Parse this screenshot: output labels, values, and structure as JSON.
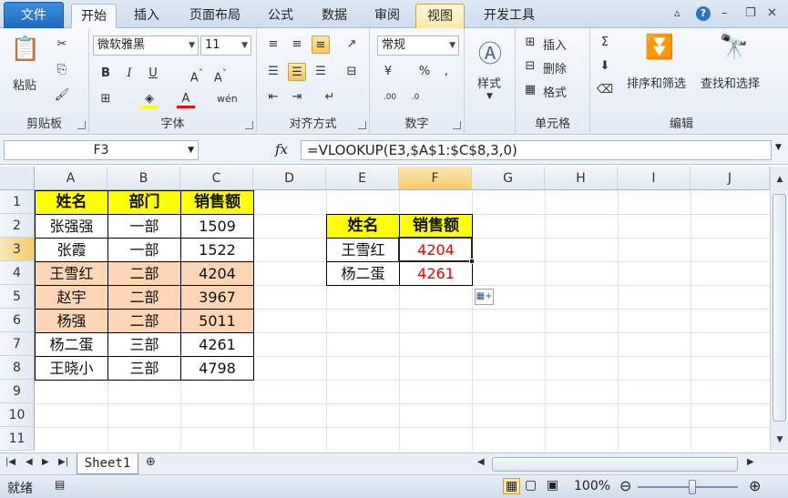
{
  "tabs": {
    "file": "文件",
    "items": [
      "开始",
      "插入",
      "页面布局",
      "公式",
      "数据",
      "审阅",
      "视图",
      "开发工具"
    ],
    "active": "开始",
    "hovered": "视图"
  },
  "ribbon": {
    "clipboard": {
      "label": "剪贴板",
      "paste": "粘贴"
    },
    "font": {
      "label": "字体",
      "name": "微软雅黑",
      "size": "11",
      "bold": "B",
      "italic": "I",
      "underline": "U"
    },
    "alignment": {
      "label": "对齐方式"
    },
    "number": {
      "label": "数字",
      "format": "常规"
    },
    "styles": {
      "label": "样式"
    },
    "cells": {
      "label": "单元格",
      "insert": "插入",
      "delete": "删除",
      "format": "格式"
    },
    "editing": {
      "label": "编辑",
      "sort_filter": "排序和筛选",
      "find_select": "查找和选择"
    }
  },
  "formula_bar": {
    "name_box": "F3",
    "fx": "fx",
    "formula": "=VLOOKUP(E3,$A$1:$C$8,3,0)"
  },
  "sheet": {
    "columns": [
      "A",
      "B",
      "C",
      "D",
      "E",
      "F",
      "G",
      "H",
      "I",
      "J"
    ],
    "rows": [
      "1",
      "2",
      "3",
      "4",
      "5",
      "6",
      "7",
      "8",
      "9",
      "10",
      "11"
    ],
    "selected_cell": "F3",
    "main_table": {
      "headers": [
        "姓名",
        "部门",
        "销售额"
      ],
      "rows": [
        [
          "张强强",
          "一部",
          "1509"
        ],
        [
          "张霞",
          "一部",
          "1522"
        ],
        [
          "王雪红",
          "二部",
          "4204"
        ],
        [
          "赵宇",
          "二部",
          "3967"
        ],
        [
          "杨强",
          "二部",
          "5011"
        ],
        [
          "杨二蛋",
          "三部",
          "4261"
        ],
        [
          "王晓小",
          "三部",
          "4798"
        ]
      ],
      "highlight_color": "#fcd5b4",
      "header_color": "#ffff00"
    },
    "lookup_table": {
      "headers": [
        "姓名",
        "销售额"
      ],
      "rows": [
        [
          "王雪红",
          "4204"
        ],
        [
          "杨二蛋",
          "4261"
        ]
      ],
      "result_color": "#ff0000"
    }
  },
  "sheet_tabs": {
    "active": "Sheet1"
  },
  "status_bar": {
    "mode": "就绪",
    "zoom": "100%"
  }
}
